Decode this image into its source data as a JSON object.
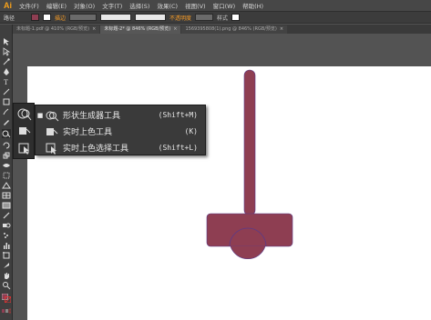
{
  "app": {
    "logo": "Ai"
  },
  "menubar": {
    "items": [
      "文件(F)",
      "编辑(E)",
      "对象(O)",
      "文字(T)",
      "选择(S)",
      "效果(C)",
      "视图(V)",
      "窗口(W)",
      "帮助(H)"
    ]
  },
  "controlbar": {
    "label_path": "路径",
    "label_stroke": "描边",
    "label_opacity": "不透明度",
    "label_basic": "基本",
    "label_style": "样式"
  },
  "tabs": [
    {
      "label": "未标题-1.pdf @ 410% (RGB/预览)",
      "active": false
    },
    {
      "label": "未标题-2* @ 846% (RGB/预览)",
      "active": true
    },
    {
      "label": "1569395808(1).png @ 846% (RGB/预览)",
      "active": false
    }
  ],
  "flyout": {
    "items": [
      {
        "label": "形状生成器工具",
        "shortcut": "(Shift+M)",
        "selected": true,
        "icon": "shape-builder-icon"
      },
      {
        "label": "实时上色工具",
        "shortcut": "(K)",
        "selected": false,
        "icon": "live-paint-bucket-icon"
      },
      {
        "label": "实时上色选择工具",
        "shortcut": "(Shift+L)",
        "selected": false,
        "icon": "live-paint-selection-icon"
      }
    ]
  },
  "colors": {
    "shape_fill": "#8e3e52",
    "shape_stroke": "#5a3a8a",
    "accent": "#f7a11a"
  }
}
